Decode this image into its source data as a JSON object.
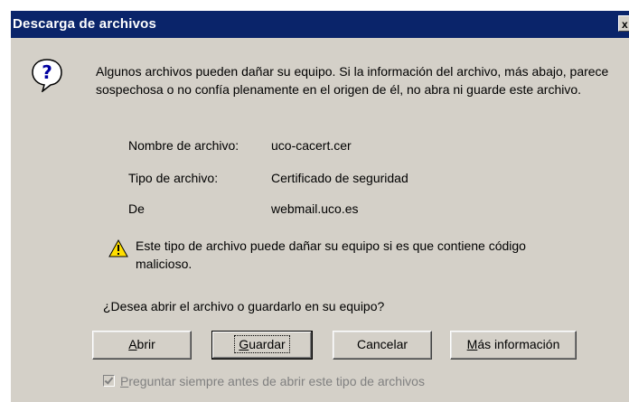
{
  "window": {
    "title": "Descarga de archivos",
    "close_label": "x"
  },
  "message": "Algunos archivos pueden dañar su equipo. Si la información del archivo, más abajo, parece sospechosa o no confía plenamente en el origen de él, no abra ni guarde este archivo.",
  "file_info": [
    {
      "label": "Nombre de archivo:",
      "value": "uco-cacert.cer"
    },
    {
      "label": "Tipo de archivo:",
      "value": "Certificado de seguridad"
    },
    {
      "label": "De",
      "value": "webmail.uco.es"
    }
  ],
  "warning": "Este tipo de archivo puede dañar su equipo si es que contiene código malicioso.",
  "question": "¿Desea abrir el archivo o guardarlo en su equipo?",
  "buttons": {
    "open": {
      "pre": "",
      "key": "A",
      "post": "brir"
    },
    "save": {
      "pre": "",
      "key": "G",
      "post": "uardar"
    },
    "cancel": {
      "label": "Cancelar"
    },
    "more": {
      "pre": "",
      "key": "M",
      "post": "ás información"
    }
  },
  "checkbox": {
    "pre": "",
    "key": "P",
    "post": "reguntar siempre antes de abrir este tipo de archivos",
    "checked": true
  },
  "icons": [
    "help-icon",
    "warning-icon",
    "close-icon",
    "checkmark-icon"
  ]
}
